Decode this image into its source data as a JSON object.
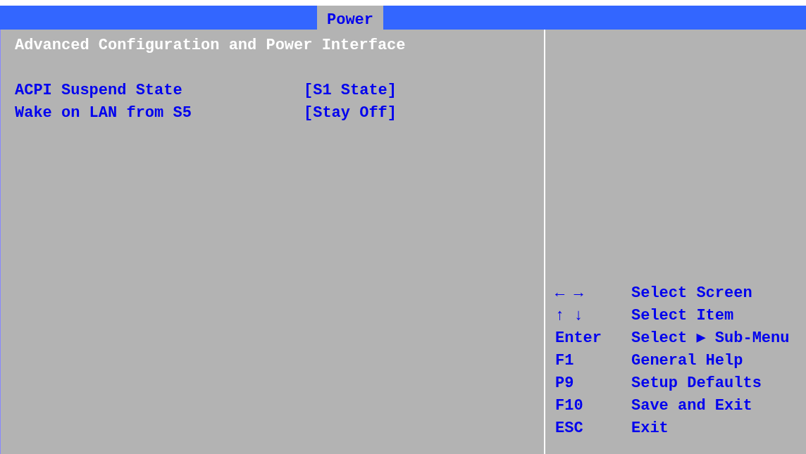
{
  "tabs": [
    {
      "label": "Power",
      "selected": true
    }
  ],
  "section_title": "Advanced Configuration and Power Interface",
  "settings": [
    {
      "label": "ACPI Suspend State",
      "value": "[S1 State]"
    },
    {
      "label": "Wake on LAN from S5",
      "value": "[Stay Off]"
    }
  ],
  "help_keys": [
    {
      "key": "← →",
      "action": "Select Screen"
    },
    {
      "key": "↑ ↓",
      "action": "Select Item"
    },
    {
      "key": "Enter",
      "action": "Select ▶ Sub-Menu"
    },
    {
      "key": "F1",
      "action": "General Help"
    },
    {
      "key": "P9",
      "action": "Setup Defaults"
    },
    {
      "key": "F10",
      "action": "Save and Exit"
    },
    {
      "key": "ESC",
      "action": "Exit"
    }
  ]
}
